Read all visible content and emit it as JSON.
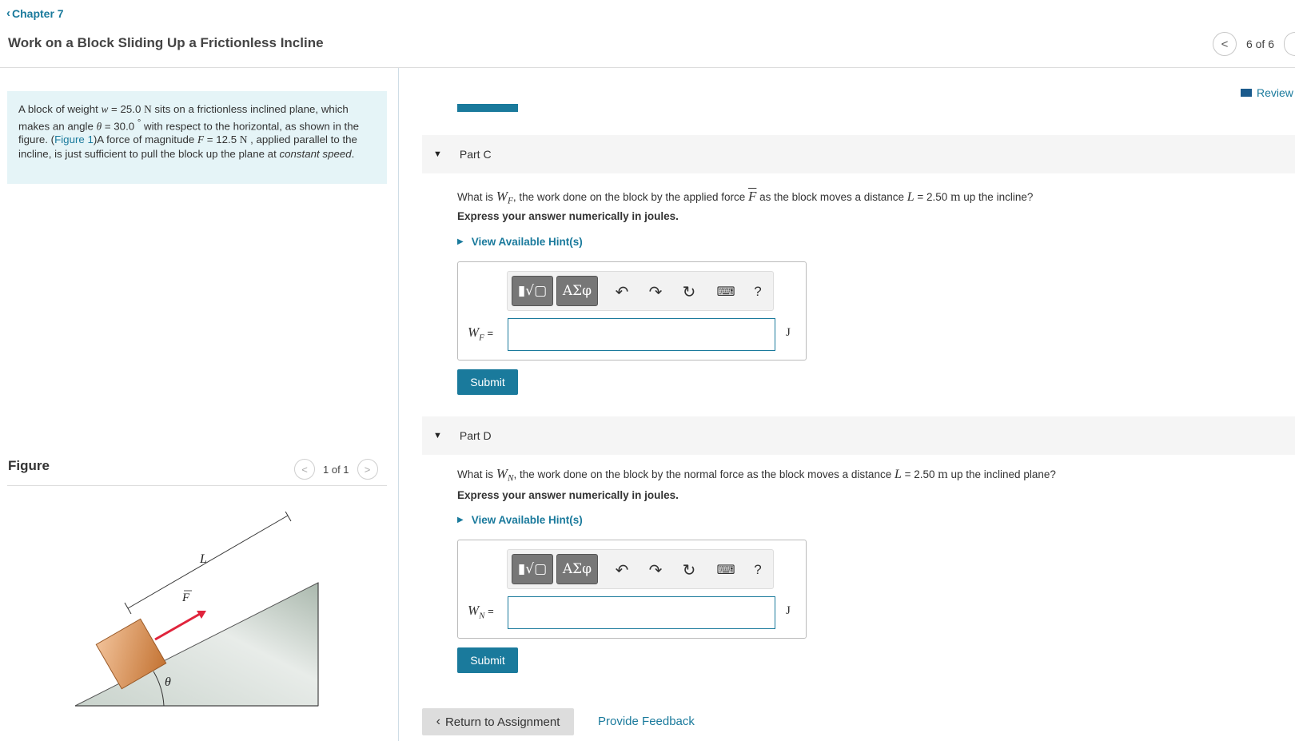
{
  "header": {
    "chapter_label": "Chapter 7",
    "title": "Work on a Block Sliding Up a Frictionless Incline",
    "pager_text": "6 of 6",
    "review_label": "Review"
  },
  "problem": {
    "t1": "A block of weight ",
    "w_sym": "w",
    "t2": " = 25.0 ",
    "unit_N": "N",
    "t3": " sits on a frictionless inclined plane, which makes an angle ",
    "theta_sym": "θ",
    "t4": " = 30.0 ",
    "deg": "°",
    "t5": " with respect to the horizontal, as shown in the figure. (",
    "figure_link": "Figure 1",
    "t6": ")A force of magnitude ",
    "F_sym": "F",
    "t7": " = 12.5 ",
    "unit_N2": "N",
    "t8": " , applied parallel to the incline, is just sufficient to pull the block up the plane at ",
    "italic_text": "constant speed",
    "t9": "."
  },
  "figure": {
    "label": "Figure",
    "pager_text": "1 of 1",
    "label_L": "L",
    "label_F": "F",
    "label_theta": "θ"
  },
  "parts": [
    {
      "header": "Part C",
      "q1": "What is ",
      "sym": "W",
      "sub": "F",
      "q2": ", the work done on the block by the applied force ",
      "vec": "F",
      "q3": " as the block moves a distance ",
      "L": "L",
      "q4": " = 2.50 ",
      "m": "m",
      "q5": " up the incline?",
      "instruction": "Express your answer numerically in joules.",
      "hint": "View Available Hint(s)",
      "answer_eq": " =",
      "unit": "J",
      "submit": "Submit",
      "toolbar": {
        "templates": "▮√▢",
        "greek": "ΑΣφ",
        "help": "?"
      }
    },
    {
      "header": "Part D",
      "q1": "What is ",
      "sym": "W",
      "sub": "N",
      "q2": ", the work done on the block by the normal force as the block moves a distance ",
      "L": "L",
      "q4": " = 2.50 ",
      "m": "m",
      "q5": " up the inclined plane?",
      "instruction": "Express your answer numerically in joules.",
      "hint": "View Available Hint(s)",
      "answer_eq": " =",
      "unit": "J",
      "submit": "Submit",
      "toolbar": {
        "templates": "▮√▢",
        "greek": "ΑΣφ",
        "help": "?"
      }
    }
  ],
  "footer": {
    "return_label": "Return to Assignment",
    "feedback_label": "Provide Feedback"
  },
  "colors": {
    "accent": "#1a7a9c",
    "problem_bg": "#e5f4f7",
    "block": "#d8955a",
    "arrow": "#e0243c",
    "incline": "#b9c6bd"
  }
}
